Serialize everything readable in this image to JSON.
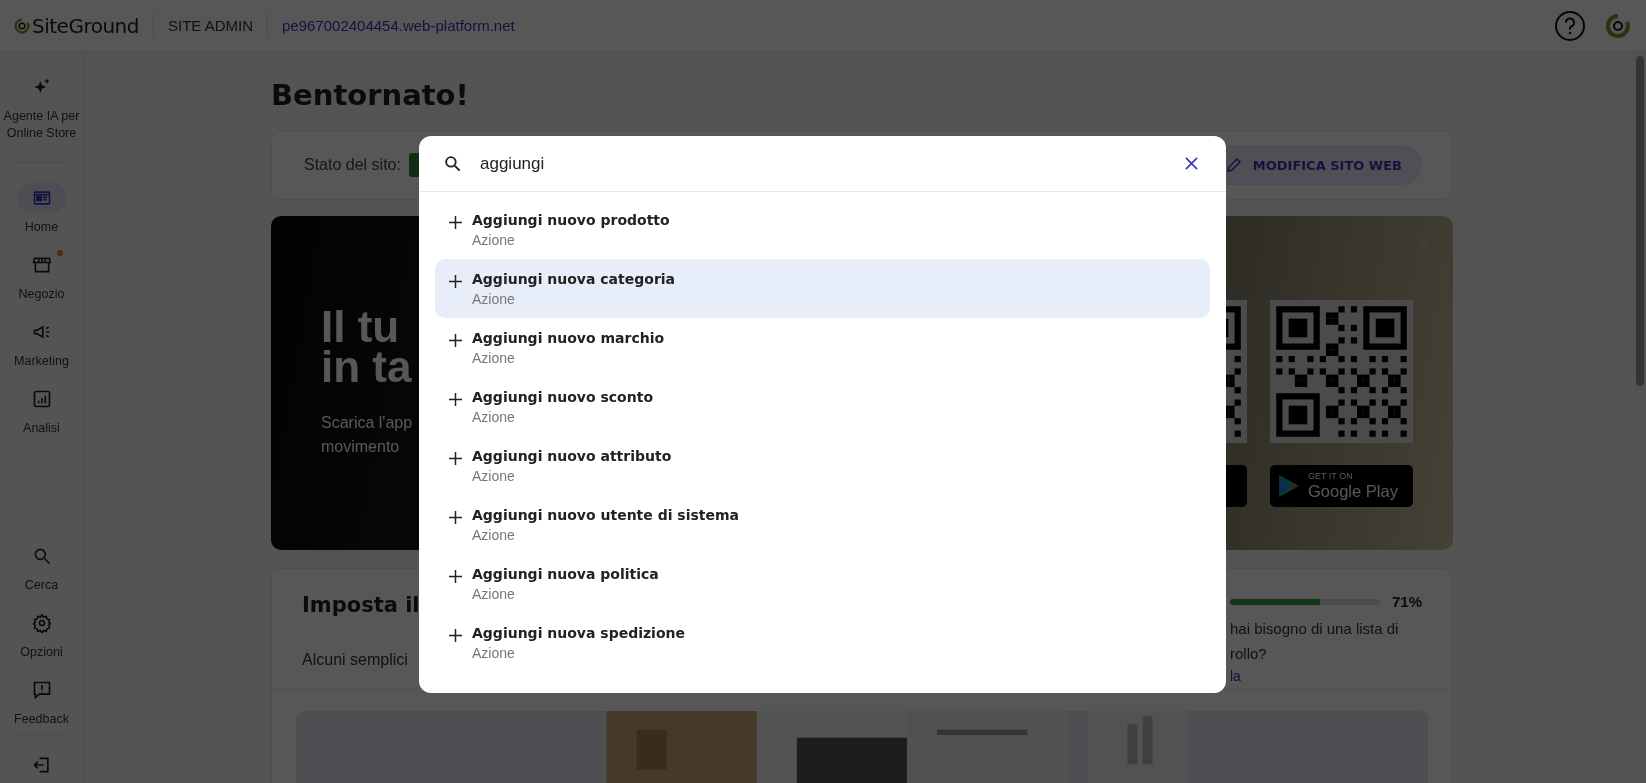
{
  "topbar": {
    "logo": "SiteGround",
    "section": "SITE ADMIN",
    "domain": "pe967002404454.web-platform.net"
  },
  "sidebar": {
    "top": [
      {
        "label": "Agente IA per Online Store",
        "selected": false,
        "notification": false
      },
      {
        "label": "Home",
        "selected": true,
        "notification": false
      },
      {
        "label": "Negozio",
        "selected": false,
        "notification": true
      },
      {
        "label": "Marketing",
        "selected": false,
        "notification": false
      },
      {
        "label": "Analisi",
        "selected": false,
        "notification": false
      }
    ],
    "bottom": [
      {
        "label": "Cerca",
        "selected": false,
        "notification": false
      },
      {
        "label": "Opzioni",
        "selected": false,
        "notification": false
      },
      {
        "label": "Feedback",
        "selected": false,
        "notification": false
      }
    ]
  },
  "page": {
    "title": "Bentornato!",
    "status_label": "Stato del sito:",
    "edit_button": "MODIFICA SITO WEB",
    "banner": {
      "title_lines": [
        "Il tu",
        "in ta"
      ],
      "text_lines": [
        "Scarica l'app",
        "movimento"
      ],
      "store_badge": {
        "caption": "GET IT ON",
        "name": "Google Play"
      }
    },
    "setup": {
      "title": "Imposta il",
      "intro": "Alcuni semplici",
      "progress": {
        "level": 0.6,
        "reading": "71%"
      },
      "help_lines": [
        "hai bisogno di una lista di",
        "rollo?"
      ],
      "link": "la"
    }
  },
  "search": {
    "query": "aggiungi",
    "results": [
      {
        "title": "Aggiungi nuovo prodotto",
        "type": "Azione",
        "selected": false
      },
      {
        "title": "Aggiungi nuova categoria",
        "type": "Azione",
        "selected": true
      },
      {
        "title": "Aggiungi nuovo marchio",
        "type": "Azione",
        "selected": false
      },
      {
        "title": "Aggiungi nuovo sconto",
        "type": "Azione",
        "selected": false
      },
      {
        "title": "Aggiungi nuovo attributo",
        "type": "Azione",
        "selected": false
      },
      {
        "title": "Aggiungi nuovo utente di sistema",
        "type": "Azione",
        "selected": false
      },
      {
        "title": "Aggiungi nuova politica",
        "type": "Azione",
        "selected": false
      },
      {
        "title": "Aggiungi nuova spedizione",
        "type": "Azione",
        "selected": false
      }
    ]
  }
}
